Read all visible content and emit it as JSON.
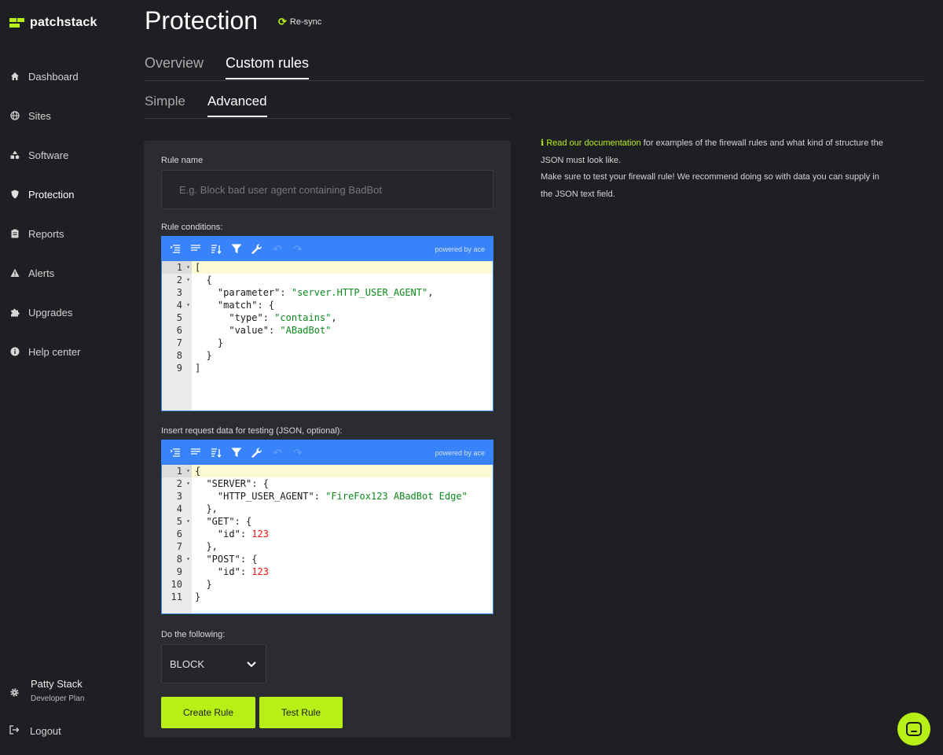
{
  "brand": {
    "name": "patchstack",
    "accent": "#b6f016"
  },
  "sidebar": {
    "items": [
      {
        "label": "Dashboard",
        "icon": "home-icon"
      },
      {
        "label": "Sites",
        "icon": "globe-icon"
      },
      {
        "label": "Software",
        "icon": "shapes-icon"
      },
      {
        "label": "Protection",
        "icon": "shield-icon"
      },
      {
        "label": "Reports",
        "icon": "clipboard-icon"
      },
      {
        "label": "Alerts",
        "icon": "warning-icon"
      },
      {
        "label": "Upgrades",
        "icon": "puzzle-icon"
      },
      {
        "label": "Help center",
        "icon": "info-icon"
      }
    ],
    "active": "Protection",
    "user": {
      "name": "Patty Stack",
      "plan": "Developer Plan"
    },
    "logout_label": "Logout"
  },
  "header": {
    "title": "Protection",
    "resync_label": "Re-sync",
    "tabs": [
      "Overview",
      "Custom rules"
    ],
    "active_tab": "Custom rules",
    "subtabs": [
      "Simple",
      "Advanced"
    ],
    "active_subtab": "Advanced"
  },
  "form": {
    "rule_name_label": "Rule name",
    "rule_name_value": "",
    "rule_name_placeholder": "E.g. Block bad user agent containing BadBot",
    "conditions_label": "Rule conditions:",
    "testing_label": "Insert request data for testing (JSON, optional):",
    "action_label": "Do the following:",
    "action_value": "BLOCK",
    "create_button": "Create Rule",
    "test_button": "Test Rule"
  },
  "editor": {
    "powered_by": "powered by ace",
    "conditions_lines": [
      [
        [
          "p",
          "["
        ]
      ],
      [
        [
          "p",
          "  {"
        ]
      ],
      [
        [
          "p",
          "    "
        ],
        [
          "k",
          "\"parameter\""
        ],
        [
          "p",
          ": "
        ],
        [
          "s",
          "\"server.HTTP_USER_AGENT\""
        ],
        [
          "p",
          ","
        ]
      ],
      [
        [
          "p",
          "    "
        ],
        [
          "k",
          "\"match\""
        ],
        [
          "p",
          ": {"
        ]
      ],
      [
        [
          "p",
          "      "
        ],
        [
          "k",
          "\"type\""
        ],
        [
          "p",
          ": "
        ],
        [
          "s",
          "\"contains\""
        ],
        [
          "p",
          ","
        ]
      ],
      [
        [
          "p",
          "      "
        ],
        [
          "k",
          "\"value\""
        ],
        [
          "p",
          ": "
        ],
        [
          "s",
          "\"ABadBot\""
        ]
      ],
      [
        [
          "p",
          "    }"
        ]
      ],
      [
        [
          "p",
          "  }"
        ]
      ],
      [
        [
          "p",
          "]"
        ]
      ]
    ],
    "conditions_folds": [
      1,
      2,
      4
    ],
    "testing_lines": [
      [
        [
          "p",
          "{"
        ]
      ],
      [
        [
          "p",
          "  "
        ],
        [
          "k",
          "\"SERVER\""
        ],
        [
          "p",
          ": {"
        ]
      ],
      [
        [
          "p",
          "    "
        ],
        [
          "k",
          "\"HTTP_USER_AGENT\""
        ],
        [
          "p",
          ": "
        ],
        [
          "s",
          "\"FireFox123 ABadBot Edge\""
        ]
      ],
      [
        [
          "p",
          "  },"
        ]
      ],
      [
        [
          "p",
          "  "
        ],
        [
          "k",
          "\"GET\""
        ],
        [
          "p",
          ": {"
        ]
      ],
      [
        [
          "p",
          "    "
        ],
        [
          "k",
          "\"id\""
        ],
        [
          "p",
          ": "
        ],
        [
          "n",
          "123"
        ]
      ],
      [
        [
          "p",
          "  },"
        ]
      ],
      [
        [
          "p",
          "  "
        ],
        [
          "k",
          "\"POST\""
        ],
        [
          "p",
          ": {"
        ]
      ],
      [
        [
          "p",
          "    "
        ],
        [
          "k",
          "\"id\""
        ],
        [
          "p",
          ": "
        ],
        [
          "n",
          "123"
        ]
      ],
      [
        [
          "p",
          "  }"
        ]
      ],
      [
        [
          "p",
          "}"
        ]
      ]
    ],
    "testing_folds": [
      1,
      2,
      5,
      8
    ]
  },
  "info": {
    "link_text": "Read our documentation",
    "line1_rest": " for examples of the firewall rules and what kind of structure the JSON must look like.",
    "line2": "Make sure to test your firewall rule! We recommend doing so with data you can supply in the JSON text field."
  }
}
